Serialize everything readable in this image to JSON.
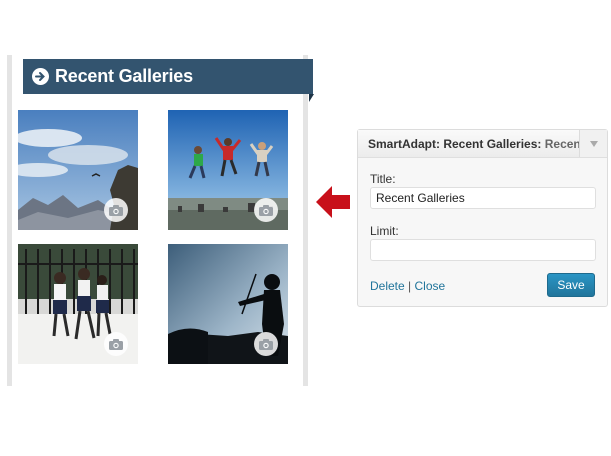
{
  "widget": {
    "title": "Recent Galleries",
    "thumbnails": [
      {
        "subject": "mountain cliff with bird",
        "icon": "camera-icon"
      },
      {
        "subject": "people jumping over city",
        "icon": "camera-icon"
      },
      {
        "subject": "schoolgirls walking",
        "icon": "camera-icon"
      },
      {
        "subject": "violinist silhouette",
        "icon": "camera-icon"
      }
    ]
  },
  "admin": {
    "heading_bold": "SmartAdapt: Recent Galleries:",
    "heading_title": "Recent",
    "title_label": "Title:",
    "title_value": "Recent Galleries",
    "limit_label": "Limit:",
    "limit_value": "",
    "delete_label": "Delete",
    "separator": "|",
    "close_label": "Close",
    "save_label": "Save"
  },
  "colors": {
    "header_bg": "#33546f",
    "arrow_red": "#c8101a",
    "save_blue": "#21759b"
  }
}
